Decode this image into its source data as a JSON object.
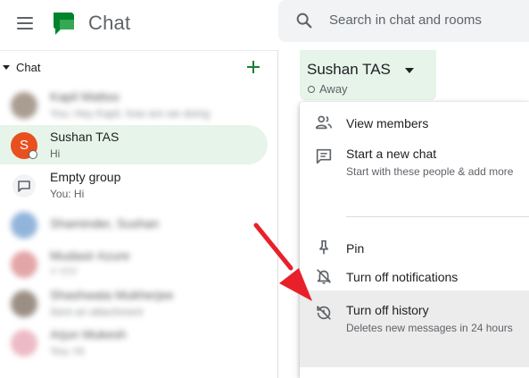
{
  "topbar": {
    "app_title": "Chat",
    "search_placeholder": "Search in chat and rooms"
  },
  "sidebar": {
    "section_label": "Chat",
    "conversations": [
      {
        "name": "Kapil Mattoo",
        "preview": "You: Hey Kapil, how are we doing",
        "blurred": true,
        "avatar_color": "#8d7b6c"
      },
      {
        "name": "Sushan TAS",
        "preview": "Hi",
        "blurred": false,
        "active": true,
        "avatar_initial": "S",
        "avatar_color": "#e8501f"
      },
      {
        "name": "Empty group",
        "preview": "You: Hi",
        "blurred": false
      },
      {
        "name": "Shaminder, Sushan",
        "preview": "",
        "blurred": true,
        "avatar_color": "#6d9ccf"
      },
      {
        "name": "Mudasir Azure",
        "preview": "? ???",
        "blurred": true,
        "avatar_color": "#d9878a"
      },
      {
        "name": "Shashwata Mukherjee",
        "preview": "Sent an attachment",
        "blurred": true,
        "avatar_color": "#7a6a5c"
      },
      {
        "name": "Arjun Mukesh",
        "preview": "You: Hi",
        "blurred": true,
        "avatar_color": "#e5a3b4"
      }
    ]
  },
  "chat_header": {
    "title": "Sushan TAS",
    "status": "Away"
  },
  "menu": {
    "items": [
      {
        "icon": "people-icon",
        "label": "View members"
      },
      {
        "icon": "chat-bubble-icon",
        "label": "Start a new chat",
        "sub": "Start with these people & add more"
      },
      {
        "icon": "pin-icon",
        "label": "Pin"
      },
      {
        "icon": "notifications-off-icon",
        "label": "Turn off notifications"
      },
      {
        "icon": "history-off-icon",
        "label": "Turn off history",
        "sub": "Deletes new messages in 24 hours",
        "highlighted": true
      }
    ]
  },
  "colors": {
    "accent_green": "#188038",
    "active_bg": "#e6f4ea",
    "annotation_red": "#e8202a",
    "highlight_bg": "#ececec"
  }
}
